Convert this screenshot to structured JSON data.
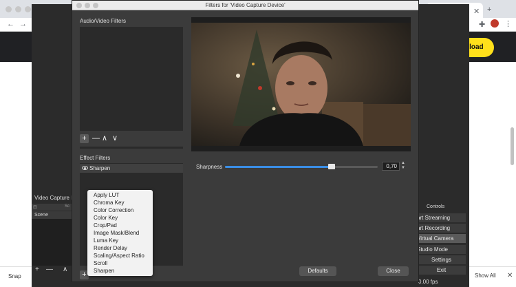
{
  "browser": {
    "download_button": "nload",
    "download_bar": {
      "item": "Snap",
      "show_all": "Show All"
    }
  },
  "obs": {
    "scene_panel_title": "Video Capture D",
    "scene_header": "Sc",
    "scene_item": "Scene",
    "scene_toolbar": {
      "add": "+",
      "remove": "—",
      "up": "∧"
    },
    "controls_title": "Controls",
    "controls": [
      "art Streaming",
      "art Recording",
      "Virtual Camera",
      "Studio Mode",
      "Settings",
      "Exit"
    ],
    "fps": "0.00 fps"
  },
  "dialog": {
    "title": "Filters for 'Video Capture Device'",
    "av_filters_label": "Audio/Video Filters",
    "effect_filters_label": "Effect Filters",
    "effect_items": [
      "Sharpen"
    ],
    "add_menu": [
      "Apply LUT",
      "Chroma Key",
      "Color Correction",
      "Color Key",
      "Crop/Pad",
      "Image Mask/Blend",
      "Luma Key",
      "Render Delay",
      "Scaling/Aspect Ratio",
      "Scroll",
      "Sharpen"
    ],
    "property": {
      "label": "Sharpness",
      "value": "0,70",
      "fraction": 0.7
    },
    "defaults_button": "Defaults",
    "close_button": "Close"
  },
  "colors": {
    "accent": "#3a8ee6",
    "yellow": "#ffe01b"
  }
}
